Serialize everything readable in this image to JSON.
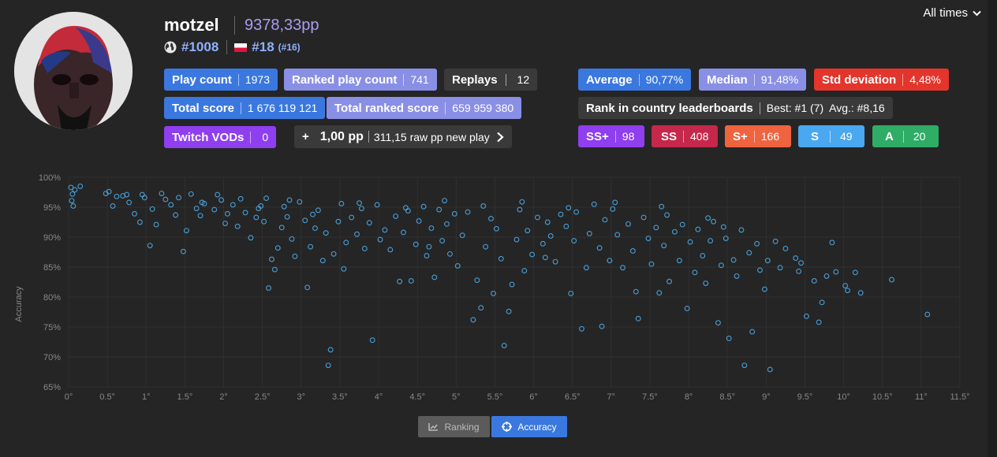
{
  "player": {
    "name": "motzel",
    "pp": "9378,33pp",
    "global_rank": "#1008",
    "country_rank": "#18",
    "country_rank_sub": "(#16)"
  },
  "time_filter": {
    "label": "All times"
  },
  "stats": {
    "play_count": {
      "label": "Play count",
      "value": "1973"
    },
    "ranked_play_count": {
      "label": "Ranked play count",
      "value": "741"
    },
    "replays": {
      "label": "Replays",
      "value": "12"
    },
    "total_score": {
      "label": "Total score",
      "value": "1 676 119 121"
    },
    "total_ranked_score": {
      "label": "Total ranked score",
      "value": "659 959 380"
    },
    "twitch_vods": {
      "label": "Twitch VODs",
      "value": "0"
    },
    "pp_gain": {
      "prefix": "+",
      "label": "1,00 pp",
      "value": "311,15 raw pp new play"
    },
    "average": {
      "label": "Average",
      "value": "90,77%"
    },
    "median": {
      "label": "Median",
      "value": "91,48%"
    },
    "std_dev": {
      "label": "Std deviation",
      "value": "4,48%"
    },
    "country_lb": {
      "label": "Rank in country leaderboards",
      "value": "Best: #1 (7)  Avg.: #8,16"
    }
  },
  "grades": [
    {
      "label": "SS+",
      "value": "98"
    },
    {
      "label": "SS",
      "value": "408"
    },
    {
      "label": "S+",
      "value": "166"
    },
    {
      "label": "S",
      "value": "49"
    },
    {
      "label": "A",
      "value": "20"
    }
  ],
  "buttons": {
    "ranking": "Ranking",
    "accuracy": "Accuracy"
  },
  "colors": {
    "accent": "#3a78e0",
    "point": "#4a9fd8",
    "grid": "#303030"
  },
  "chart_data": {
    "type": "scatter",
    "ylabel": "Accuracy",
    "xlim": [
      0,
      11.5
    ],
    "ylim": [
      65,
      100
    ],
    "x_ticks": [
      "0°",
      "0.5°",
      "1°",
      "1.5°",
      "2°",
      "2.5°",
      "3°",
      "3.5°",
      "4°",
      "4.5°",
      "5°",
      "5.5°",
      "6°",
      "6.5°",
      "7°",
      "7.5°",
      "8°",
      "8.5°",
      "9°",
      "9.5°",
      "10°",
      "10.5°",
      "11°",
      "11.5°"
    ],
    "y_ticks": [
      "100%",
      "95%",
      "90%",
      "85%",
      "80%",
      "75%",
      "70%",
      "65%"
    ],
    "series": [
      {
        "points": [
          [
            0.03,
            98.3
          ],
          [
            0.05,
            97.2
          ],
          [
            0.04,
            96.1
          ],
          [
            0.06,
            95.2
          ],
          [
            0.08,
            97.9
          ],
          [
            0.15,
            98.5
          ],
          [
            0.48,
            97.3
          ],
          [
            0.52,
            97.6
          ],
          [
            0.57,
            95.2
          ],
          [
            0.62,
            96.8
          ],
          [
            0.7,
            96.9
          ],
          [
            0.75,
            97.1
          ],
          [
            0.78,
            95.8
          ],
          [
            0.85,
            93.9
          ],
          [
            0.92,
            92.5
          ],
          [
            0.95,
            97.1
          ],
          [
            0.98,
            96.6
          ],
          [
            1.05,
            88.6
          ],
          [
            1.08,
            94.7
          ],
          [
            1.13,
            92.1
          ],
          [
            1.2,
            97.3
          ],
          [
            1.25,
            96.3
          ],
          [
            1.32,
            95.4
          ],
          [
            1.38,
            93.7
          ],
          [
            1.42,
            96.6
          ],
          [
            1.48,
            87.6
          ],
          [
            1.52,
            91.1
          ],
          [
            1.58,
            97.2
          ],
          [
            1.65,
            94.8
          ],
          [
            1.7,
            93.6
          ],
          [
            1.72,
            95.8
          ],
          [
            1.88,
            94.6
          ],
          [
            1.92,
            97.1
          ],
          [
            1.97,
            96.2
          ],
          [
            2.02,
            92.3
          ],
          [
            2.05,
            93.9
          ],
          [
            2.12,
            95.4
          ],
          [
            2.18,
            91.8
          ],
          [
            2.22,
            96.4
          ],
          [
            2.28,
            94.1
          ],
          [
            2.35,
            89.9
          ],
          [
            2.42,
            93.3
          ],
          [
            2.48,
            95.2
          ],
          [
            2.52,
            92.6
          ],
          [
            2.55,
            96.5
          ],
          [
            2.58,
            81.5
          ],
          [
            2.62,
            86.3
          ],
          [
            2.66,
            84.6
          ],
          [
            2.7,
            88.2
          ],
          [
            2.75,
            91.6
          ],
          [
            2.78,
            95.1
          ],
          [
            2.82,
            93.4
          ],
          [
            2.88,
            89.7
          ],
          [
            2.92,
            86.8
          ],
          [
            2.98,
            95.9
          ],
          [
            3.05,
            92.8
          ],
          [
            3.08,
            81.6
          ],
          [
            3.12,
            88.4
          ],
          [
            3.18,
            91.5
          ],
          [
            3.22,
            94.5
          ],
          [
            3.28,
            86.1
          ],
          [
            3.32,
            90.7
          ],
          [
            3.35,
            68.6
          ],
          [
            3.38,
            71.2
          ],
          [
            3.42,
            87.2
          ],
          [
            3.48,
            92.6
          ],
          [
            3.52,
            95.6
          ],
          [
            3.55,
            84.7
          ],
          [
            3.58,
            89.1
          ],
          [
            3.65,
            93.3
          ],
          [
            3.72,
            90.5
          ],
          [
            3.78,
            94.8
          ],
          [
            3.82,
            88.1
          ],
          [
            3.88,
            92.4
          ],
          [
            3.92,
            72.8
          ],
          [
            3.98,
            95.4
          ],
          [
            4.02,
            89.6
          ],
          [
            4.08,
            91.2
          ],
          [
            4.15,
            87.9
          ],
          [
            4.22,
            93.5
          ],
          [
            4.27,
            82.6
          ],
          [
            4.32,
            90.8
          ],
          [
            4.38,
            94.4
          ],
          [
            4.42,
            82.7
          ],
          [
            4.48,
            88.8
          ],
          [
            4.52,
            92.7
          ],
          [
            4.58,
            95.1
          ],
          [
            4.62,
            86.9
          ],
          [
            4.68,
            91.5
          ],
          [
            4.72,
            83.3
          ],
          [
            4.78,
            94.6
          ],
          [
            4.82,
            89.4
          ],
          [
            4.88,
            92.2
          ],
          [
            4.92,
            87.2
          ],
          [
            4.98,
            93.9
          ],
          [
            5.02,
            85.2
          ],
          [
            5.08,
            90.3
          ],
          [
            5.15,
            94.2
          ],
          [
            5.22,
            76.2
          ],
          [
            5.27,
            82.8
          ],
          [
            5.32,
            78.2
          ],
          [
            5.38,
            88.4
          ],
          [
            5.45,
            93.1
          ],
          [
            5.48,
            80.6
          ],
          [
            5.52,
            91.4
          ],
          [
            5.58,
            86.4
          ],
          [
            5.62,
            71.9
          ],
          [
            5.68,
            77.6
          ],
          [
            5.72,
            82.1
          ],
          [
            5.78,
            89.6
          ],
          [
            5.82,
            94.6
          ],
          [
            5.88,
            84.4
          ],
          [
            5.92,
            91.1
          ],
          [
            5.98,
            87.1
          ],
          [
            6.05,
            93.3
          ],
          [
            6.12,
            88.9
          ],
          [
            6.18,
            92.5
          ],
          [
            6.22,
            90.2
          ],
          [
            6.28,
            85.9
          ],
          [
            6.35,
            93.8
          ],
          [
            6.42,
            91.8
          ],
          [
            6.48,
            80.6
          ],
          [
            6.52,
            89.4
          ],
          [
            6.55,
            94.2
          ],
          [
            6.62,
            74.7
          ],
          [
            6.68,
            84.9
          ],
          [
            6.72,
            90.6
          ],
          [
            6.78,
            95.5
          ],
          [
            6.85,
            88.2
          ],
          [
            6.88,
            75.1
          ],
          [
            6.92,
            92.9
          ],
          [
            6.98,
            86.1
          ],
          [
            7.02,
            94.7
          ],
          [
            7.08,
            90.4
          ],
          [
            7.15,
            84.9
          ],
          [
            7.22,
            92.2
          ],
          [
            7.28,
            87.7
          ],
          [
            7.32,
            80.9
          ],
          [
            7.35,
            76.4
          ],
          [
            7.42,
            93.3
          ],
          [
            7.48,
            89.8
          ],
          [
            7.52,
            85.5
          ],
          [
            7.58,
            91.6
          ],
          [
            7.62,
            80.7
          ],
          [
            7.68,
            88.6
          ],
          [
            7.72,
            93.7
          ],
          [
            7.75,
            82.6
          ],
          [
            7.82,
            90.9
          ],
          [
            7.88,
            86.1
          ],
          [
            7.92,
            92.1
          ],
          [
            7.98,
            78.1
          ],
          [
            8.02,
            89.2
          ],
          [
            8.08,
            84.1
          ],
          [
            8.12,
            91.3
          ],
          [
            8.18,
            86.9
          ],
          [
            8.22,
            82.3
          ],
          [
            8.28,
            89.4
          ],
          [
            8.32,
            92.6
          ],
          [
            8.38,
            75.7
          ],
          [
            8.42,
            85.3
          ],
          [
            8.48,
            89.8
          ],
          [
            8.52,
            73.1
          ],
          [
            8.58,
            86.2
          ],
          [
            8.62,
            83.5
          ],
          [
            8.68,
            91.2
          ],
          [
            8.72,
            68.6
          ],
          [
            8.78,
            87.4
          ],
          [
            8.82,
            74.2
          ],
          [
            8.88,
            88.9
          ],
          [
            8.92,
            84.5
          ],
          [
            8.98,
            81.3
          ],
          [
            9.02,
            86.1
          ],
          [
            9.05,
            67.9
          ],
          [
            9.12,
            89.3
          ],
          [
            9.18,
            84.9
          ],
          [
            9.25,
            88.1
          ],
          [
            9.38,
            86.5
          ],
          [
            9.42,
            84.3
          ],
          [
            9.52,
            76.8
          ],
          [
            9.62,
            82.7
          ],
          [
            9.68,
            75.8
          ],
          [
            9.72,
            79.1
          ],
          [
            9.78,
            83.5
          ],
          [
            9.85,
            89.1
          ],
          [
            9.9,
            84.2
          ],
          [
            10.02,
            81.9
          ],
          [
            10.05,
            81.1
          ],
          [
            10.15,
            84.1
          ],
          [
            10.22,
            80.7
          ],
          [
            10.62,
            82.9
          ],
          [
            11.08,
            77.1
          ],
          [
            1.75,
            95.6
          ],
          [
            2.45,
            94.8
          ],
          [
            2.85,
            96.2
          ],
          [
            3.15,
            93.8
          ],
          [
            3.75,
            95.7
          ],
          [
            4.35,
            94.9
          ],
          [
            4.85,
            96.1
          ],
          [
            5.35,
            95.2
          ],
          [
            5.85,
            95.9
          ],
          [
            6.45,
            94.9
          ],
          [
            7.05,
            95.8
          ],
          [
            7.65,
            95.1
          ],
          [
            8.25,
            93.2
          ],
          [
            8.45,
            91.7
          ],
          [
            9.45,
            85.7
          ],
          [
            6.15,
            86.6
          ],
          [
            4.65,
            88.4
          ]
        ]
      }
    ]
  }
}
